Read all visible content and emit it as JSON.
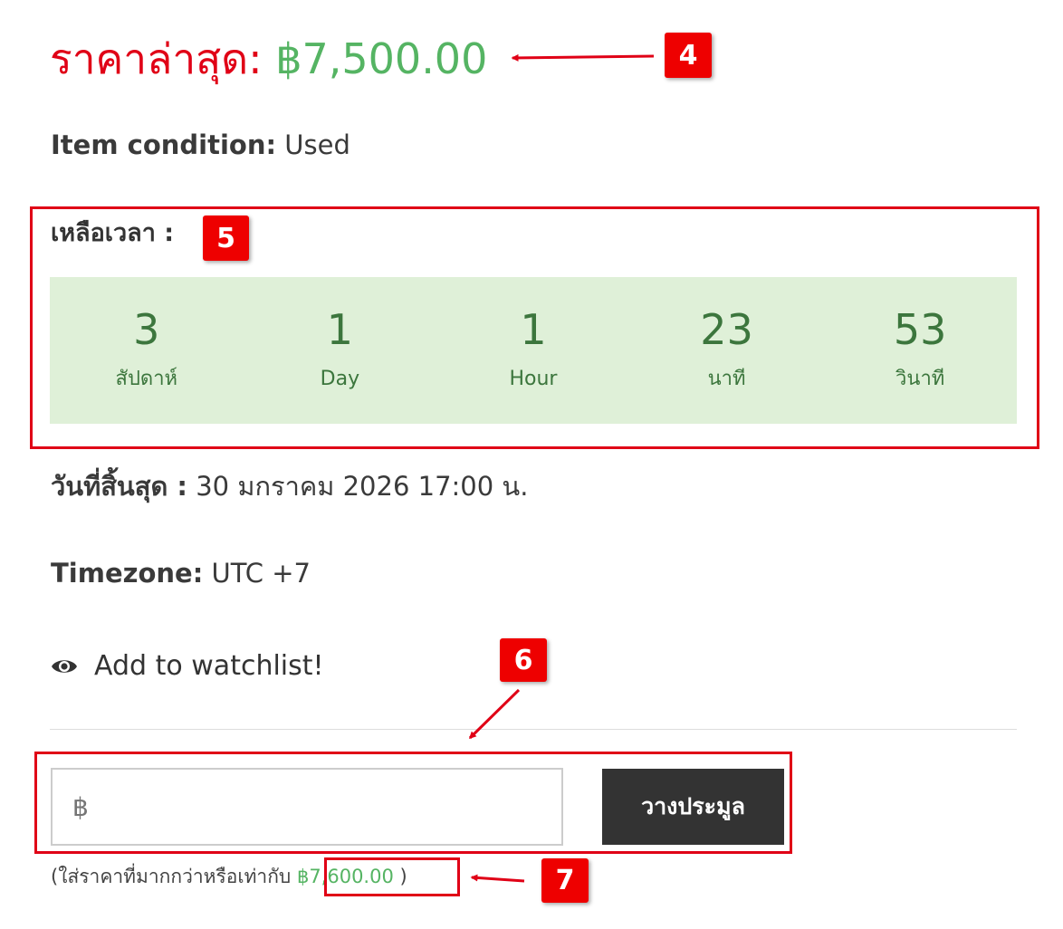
{
  "price": {
    "label": "ราคาล่าสุด:",
    "value": "฿7,500.00"
  },
  "item_condition": {
    "label": "Item condition:",
    "value": "Used"
  },
  "time_remaining": {
    "label": "เหลือเวลา :",
    "units": [
      {
        "value": "3",
        "unit": "สัปดาห์"
      },
      {
        "value": "1",
        "unit": "Day"
      },
      {
        "value": "1",
        "unit": "Hour"
      },
      {
        "value": "23",
        "unit": "นาที"
      },
      {
        "value": "53",
        "unit": "วินาที"
      }
    ]
  },
  "end_date": {
    "label": "วันที่สิ้นสุด :",
    "value": "30 มกราคม 2026 17:00 น."
  },
  "timezone": {
    "label": "Timezone:",
    "value": "UTC +7"
  },
  "watchlist": {
    "label": "Add to watchlist!",
    "icon": "eye-icon"
  },
  "bid_form": {
    "currency_prefix": "฿",
    "input_value": "",
    "button_label": "วางประมูล"
  },
  "hint": {
    "prefix": "(ใส่ราคาที่มากกว่าหรือเท่ากับ",
    "amount": "฿7,600.00",
    "suffix": ")"
  },
  "annotations": {
    "badge_4": "4",
    "badge_5": "5",
    "badge_6": "6",
    "badge_7": "7"
  },
  "colors": {
    "annotation_red": "#e00016",
    "price_green": "#55b463",
    "countdown_bg": "#dff0d8",
    "countdown_text": "#3c763d",
    "button_dark": "#333333"
  }
}
